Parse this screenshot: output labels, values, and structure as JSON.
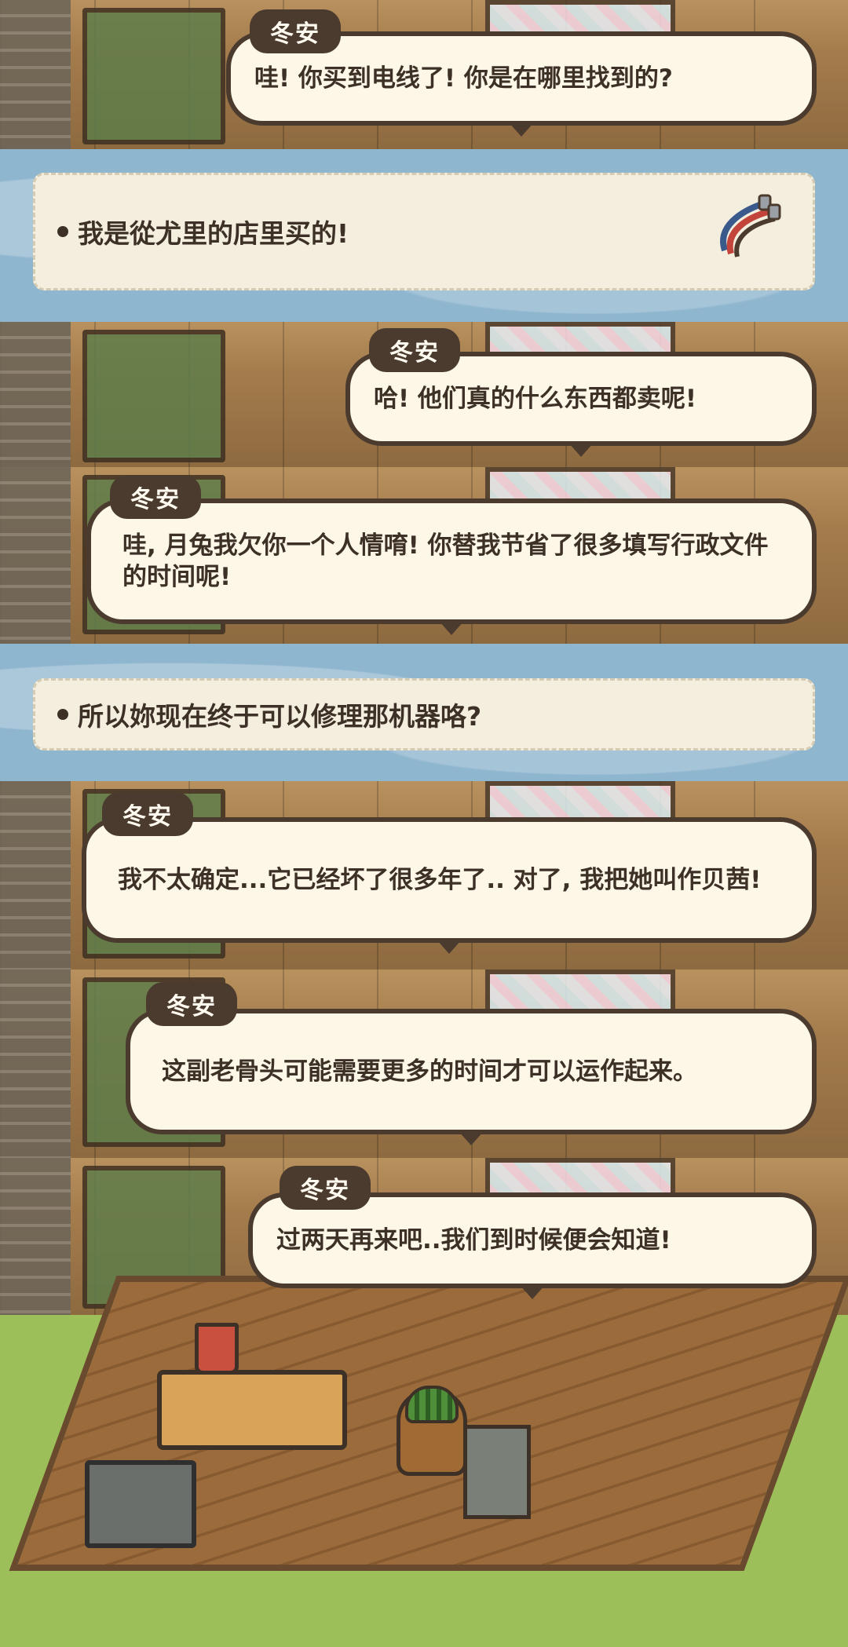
{
  "panels": [
    {
      "speaker": "冬安",
      "text": "哇! 你买到电线了! 你是在哪里找到的?"
    },
    {
      "choice": "我是從尤里的店里买的!",
      "icon": "cable-icon"
    },
    {
      "speaker": "冬安",
      "text": "哈! 他们真的什么东西都卖呢!"
    },
    {
      "speaker": "冬安",
      "text": "哇, 月兔我欠你一个人情唷! 你替我节省了很多填写行政文件的时间呢!"
    },
    {
      "choice": "所以妳现在终于可以修理那机器咯?"
    },
    {
      "speaker": "冬安",
      "text": "我不太确定...它已经坏了很多年了.. 对了, 我把她叫作贝茜!"
    },
    {
      "speaker": "冬安",
      "text": "这副老骨头可能需要更多的时间才可以运作起来。"
    },
    {
      "speaker": "冬安",
      "text": "过两天再来吧..我们到时候便会知道!"
    }
  ],
  "colors": {
    "bubble_bg": "#fcf7e6",
    "outline": "#4b3b2f",
    "choice_bg": "#f3eede",
    "water": "#8fb6cf"
  }
}
